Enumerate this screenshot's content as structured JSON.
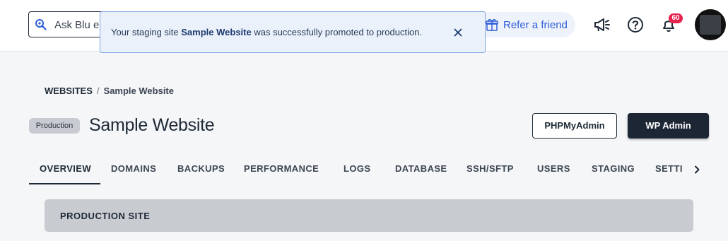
{
  "header": {
    "search_placeholder": "Ask Blu e",
    "refer_label": "Refer a friend",
    "notifications_count": "60",
    "accent_color": "#2b5bd7",
    "badge_color": "#e5234d"
  },
  "toast": {
    "prefix": "Your staging site ",
    "site": "Sample Website",
    "suffix": " was successfully promoted to production."
  },
  "breadcrumb": {
    "root": "WEBSITES",
    "separator": "/",
    "current": "Sample Website"
  },
  "site": {
    "environment": "Production",
    "title": "Sample Website"
  },
  "actions": {
    "phpmyadmin": "PHPMyAdmin",
    "wp_admin": "WP Admin"
  },
  "tabs": [
    {
      "label": "OVERVIEW",
      "active": true
    },
    {
      "label": "DOMAINS"
    },
    {
      "label": "BACKUPS"
    },
    {
      "label": "PERFORMANCE"
    },
    {
      "label": "LOGS"
    },
    {
      "label": "DATABASE"
    },
    {
      "label": "SSH/SFTP"
    },
    {
      "label": "USERS"
    },
    {
      "label": "STAGING"
    },
    {
      "label": "SETTI"
    }
  ],
  "section": {
    "title": "PRODUCTION SITE"
  }
}
